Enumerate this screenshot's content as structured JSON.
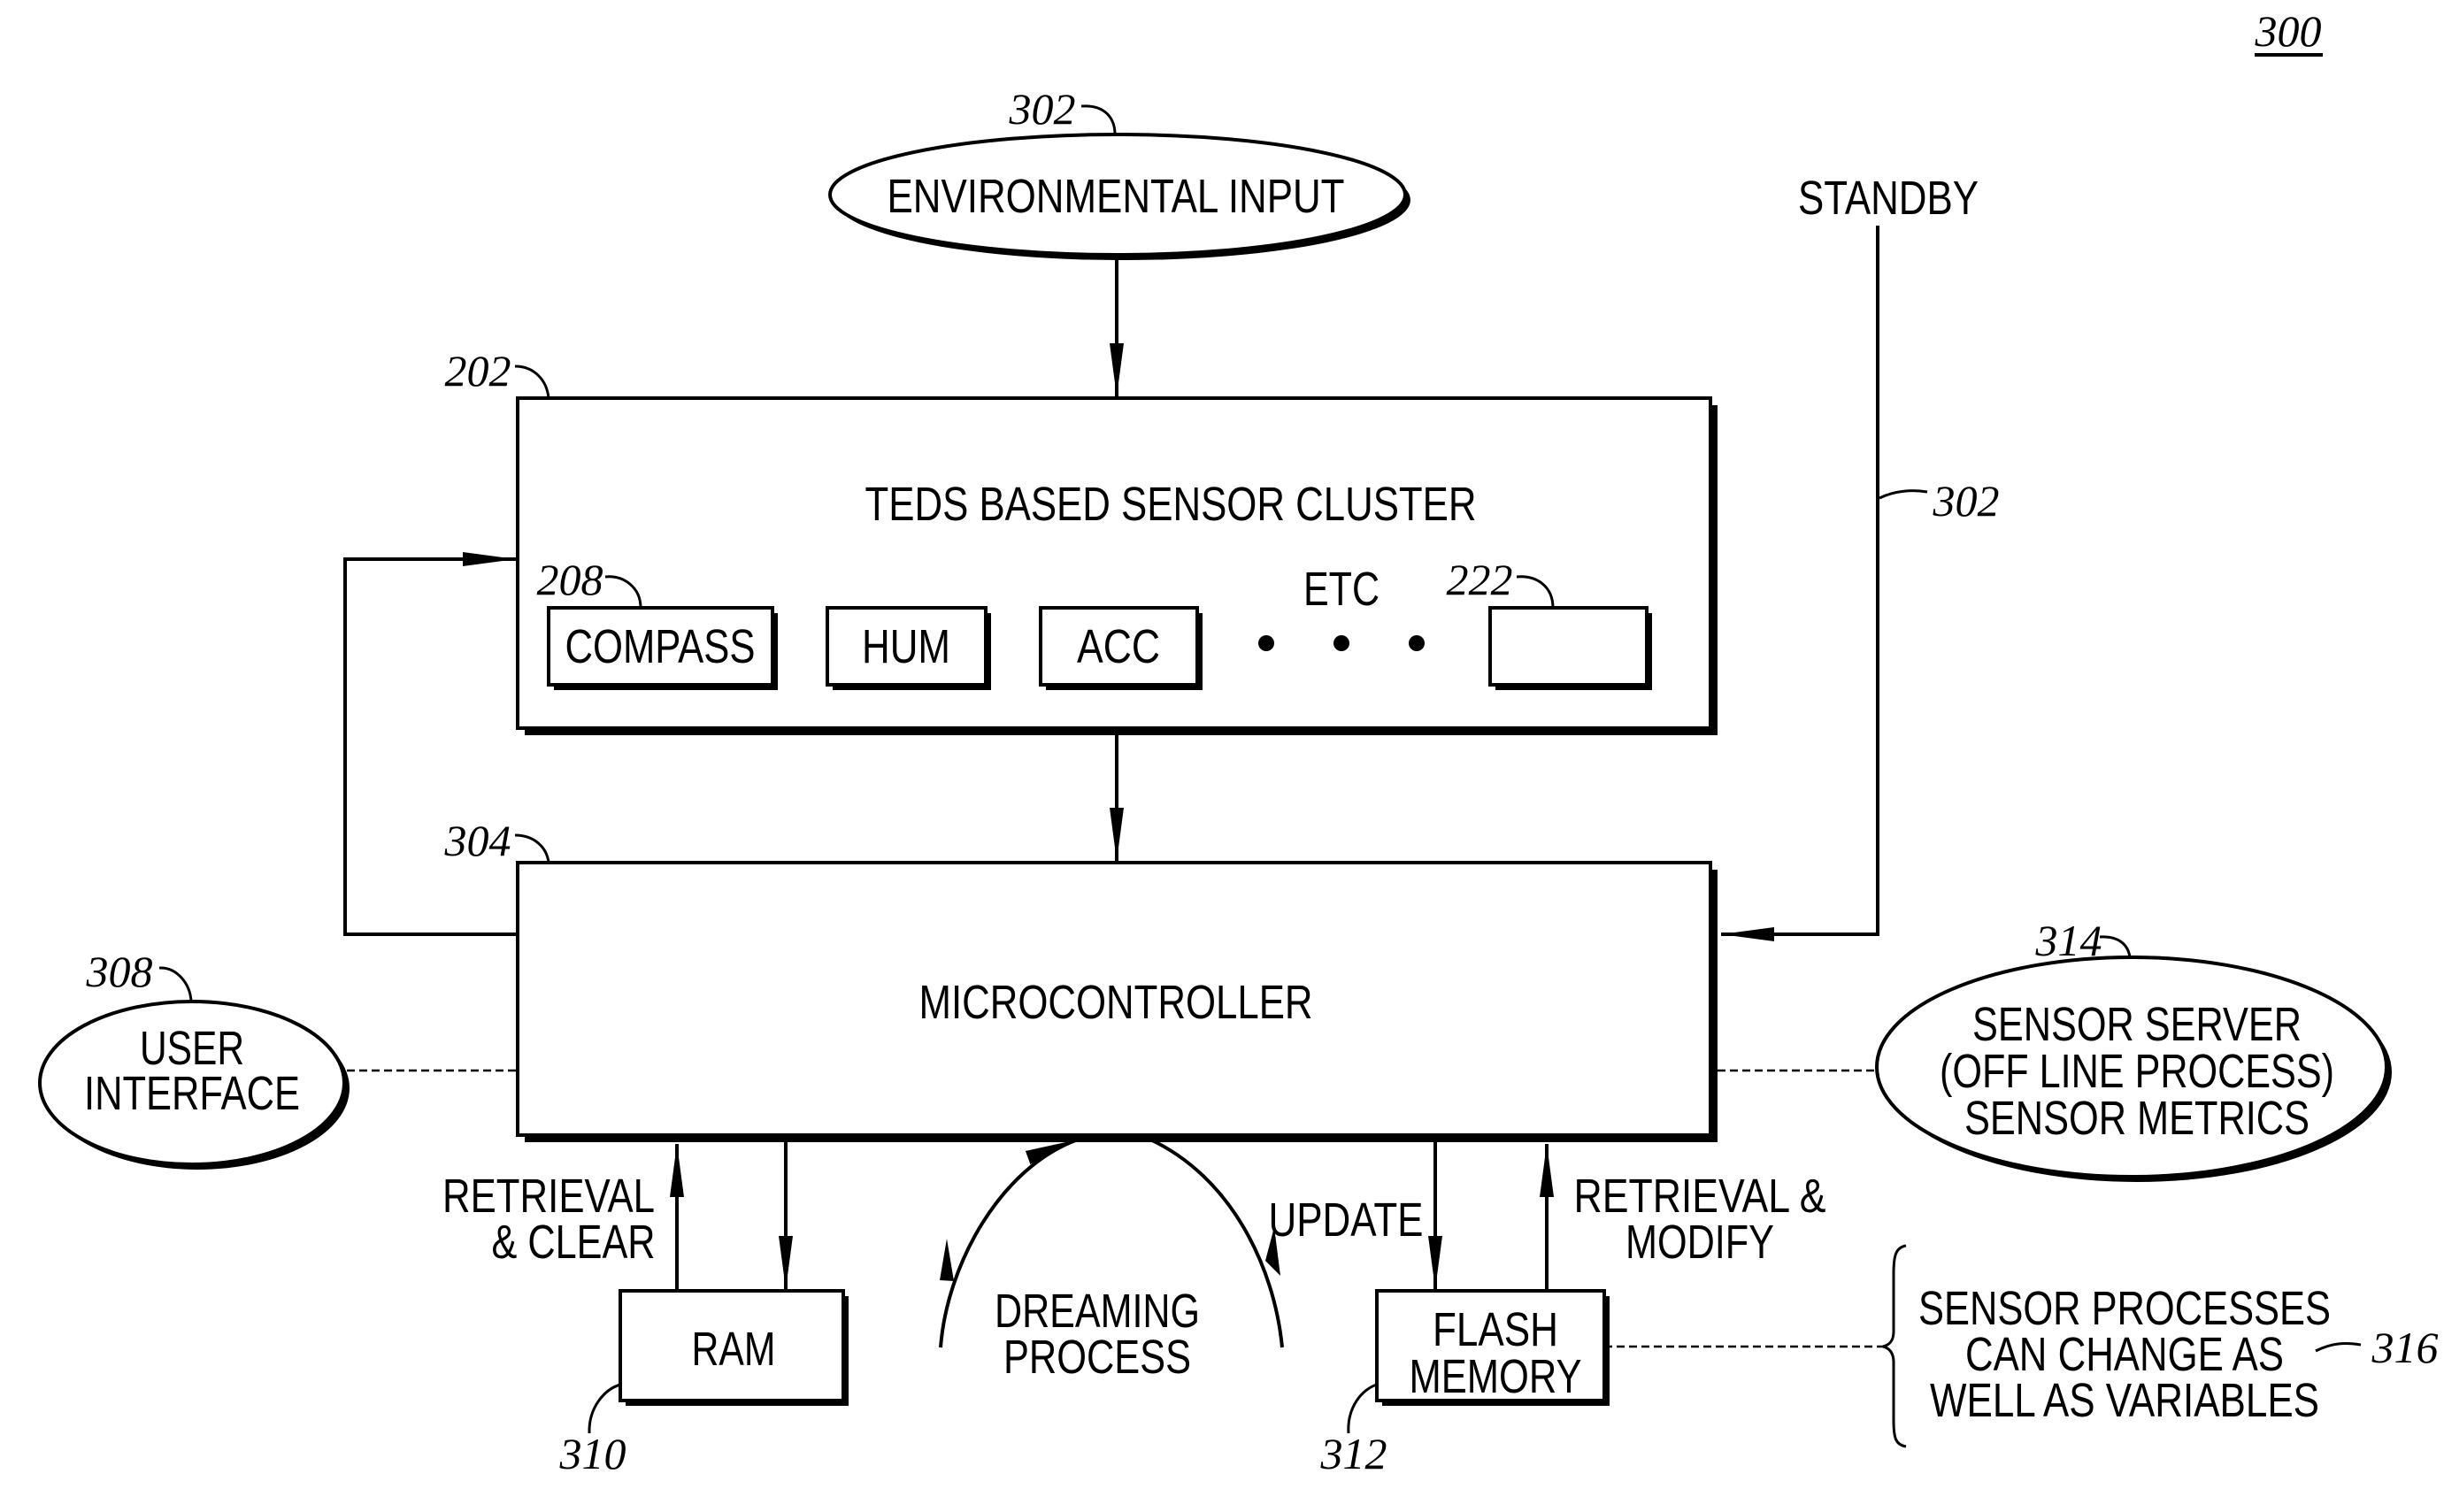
{
  "figure": {
    "number": "300",
    "blocks": {
      "environmental_input": {
        "label": "ENVIRONMENTAL INPUT",
        "ref": "302"
      },
      "sensor_cluster": {
        "label": "TEDS BASED SENSOR CLUSTER",
        "ref": "202",
        "sensors": [
          {
            "label": "COMPASS",
            "ref": "208"
          },
          {
            "label": "HUM"
          },
          {
            "label": "ACC"
          },
          {
            "label": "",
            "ref": "222"
          }
        ],
        "etc_label": "ETC"
      },
      "microcontroller": {
        "label": "MICROCONTROLLER",
        "ref": "304"
      },
      "standby": {
        "label": "STANDBY",
        "ref": "302"
      },
      "user_interface": {
        "lines": [
          "USER",
          "INTERFACE"
        ],
        "ref": "308"
      },
      "sensor_server": {
        "lines": [
          "SENSOR SERVER",
          "(OFF LINE PROCESS)",
          "SENSOR METRICS"
        ],
        "ref": "314"
      },
      "ram": {
        "label": "RAM",
        "ref": "310"
      },
      "flash": {
        "lines": [
          "FLASH",
          "MEMORY"
        ],
        "ref": "312"
      },
      "note": {
        "lines": [
          "SENSOR PROCESSES",
          "CAN CHANGE AS",
          "WELL AS VARIABLES"
        ],
        "ref": "316"
      }
    },
    "edge_labels": {
      "retrieval_clear": [
        "RETRIEVAL",
        "& CLEAR"
      ],
      "dreaming": [
        "DREAMING",
        "PROCESS"
      ],
      "update": "UPDATE",
      "retrieval_modify": [
        "RETRIEVAL &",
        "MODIFY"
      ]
    }
  }
}
